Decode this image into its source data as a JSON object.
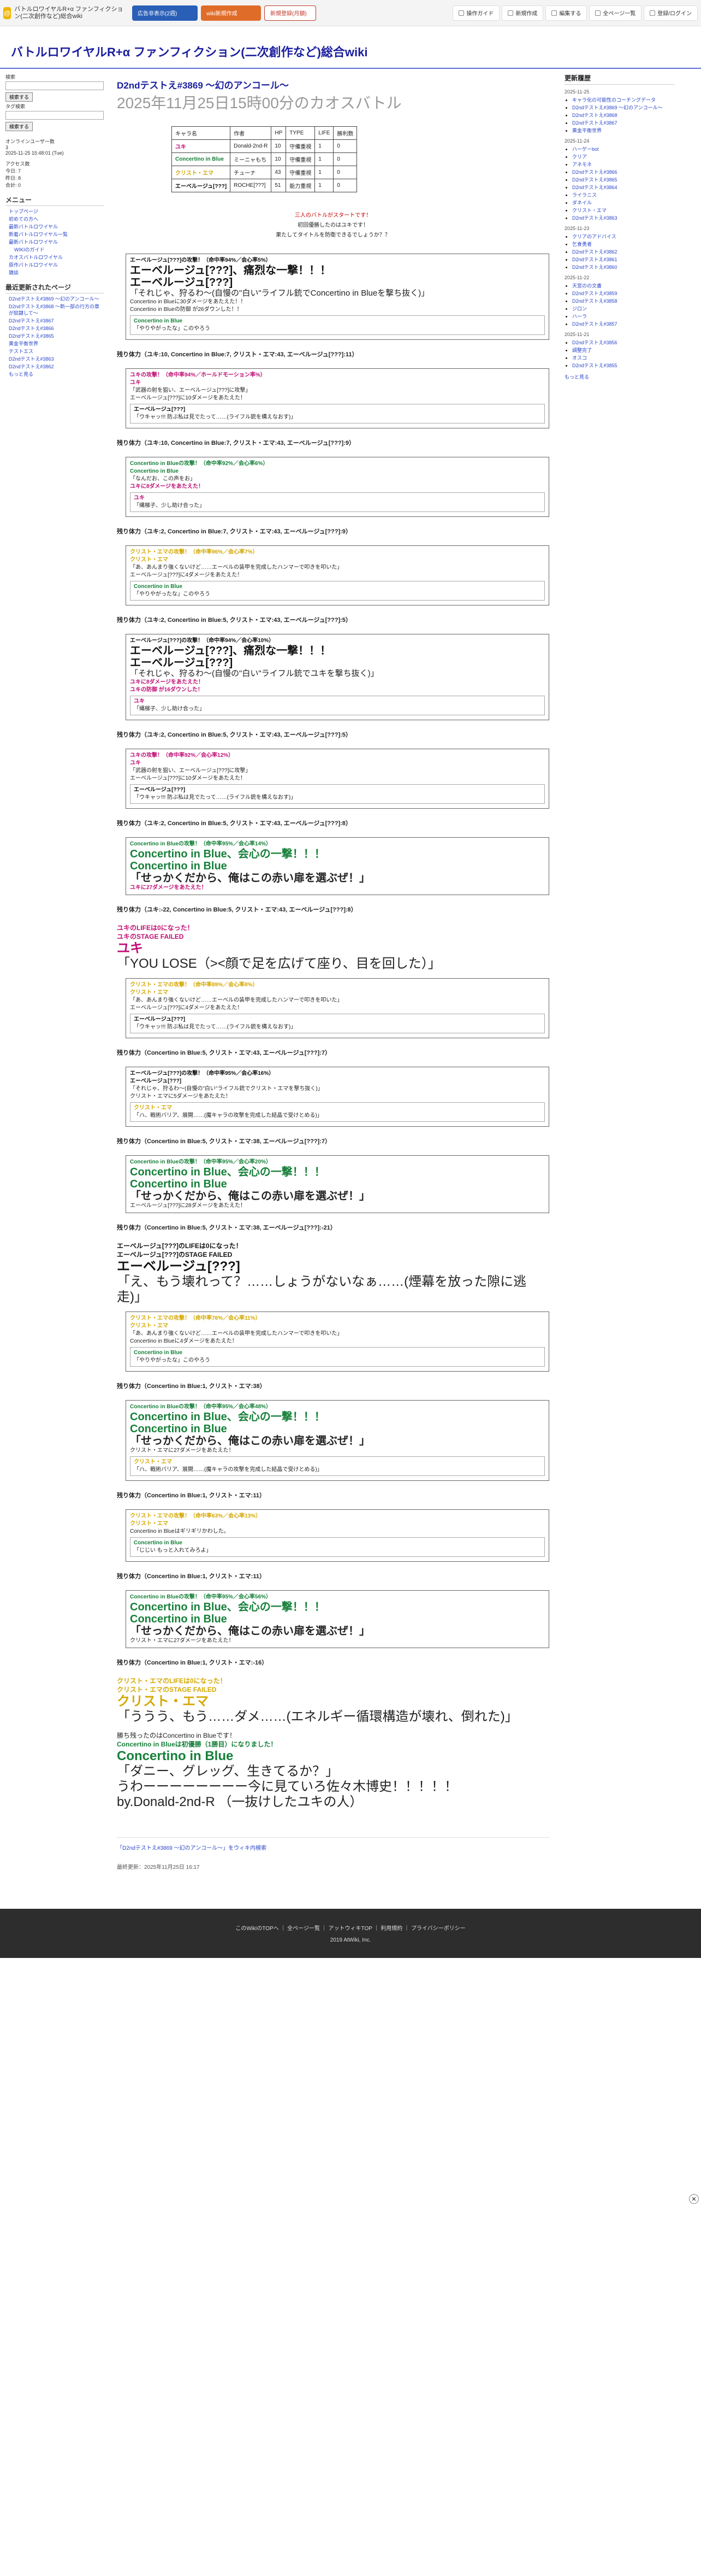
{
  "header": {
    "site_name": "バトルロワイヤルR+α ファンフィクション(二次創作など)総合wiki",
    "btn1": "広告非表示(2週)",
    "btn2": "wiki新規作成",
    "btn3": "新規登録(月額)",
    "nav": [
      "操作ガイド",
      "新規作成",
      "編集する",
      "全ページ一覧",
      "登録/ログイン"
    ]
  },
  "site_title": "バトルロワイヤルR+α ファンフィクション(二次創作など)総合wiki",
  "left": {
    "search_label": "検索",
    "search_btn": "検索する",
    "tag_label": "タグ検索",
    "tag_btn": "検索する",
    "online": "オンラインユーザー数",
    "online_val": "3",
    "stamp": "2025-11-25 15:48:01 (Tue)",
    "access": "アクセス数",
    "today": "今日: 7",
    "yesterday": "昨日: 8",
    "total": "合計: 0",
    "menu": "メニュー",
    "menu_items": [
      "トップページ",
      "初めての方へ",
      "最新バトルロワイヤル",
      "新着バトルロワイヤル一覧",
      "最新バトルロワイヤル",
      "WIKIのガイド",
      "カオスバトルロワイヤル",
      "原作バトルロワイヤル",
      "雑談"
    ],
    "related": "最近更新されたページ",
    "recent_items": [
      "D2ndテストえ#3869 〜幻のアンコール〜",
      "D2ndテストえ#3868 〜新一部の行方の章が奴隷して〜",
      "D2ndテストえ#3867",
      "D2ndテストえ#3866",
      "D2ndテストえ#3865",
      "黄金平衡世界",
      "テストエス",
      "D2ndテストえ#3863",
      "D2ndテストえ#3862",
      "もっと見る"
    ]
  },
  "page": {
    "title": "D2ndテストえ#3869 〜幻のアンコール〜",
    "subtitle": "2025年11月25日15時00分のカオスバトル"
  },
  "table": {
    "headers": [
      "キャラ名",
      "作者",
      "HP",
      "TYPE",
      "LIFE",
      "勝利数"
    ],
    "rows": [
      [
        "ユキ",
        "Donald-2nd-R",
        "10",
        "守備重視",
        "1",
        "0"
      ],
      [
        "Concertino in Blue",
        "ミーニャもち",
        "10",
        "守備重視",
        "1",
        "0"
      ],
      [
        "クリスト・エマ",
        "チューナ",
        "43",
        "守備重視",
        "1",
        "0"
      ],
      [
        "エーベルージュ[???]",
        "ROCHE[???]",
        "51",
        "能力重視",
        "1",
        "0"
      ]
    ]
  },
  "intro": {
    "l1": "三人のバトルがスタートです！",
    "l2": "初回優勝したのはユキです！",
    "l3": "果たしてタイトルを防衛できるでしょうか？？"
  },
  "rem_label": "残り体力",
  "footer_links": "このWikiのTOPへ ｜ 全ページ一覧 ｜ アットウィキTOP ｜ 利用規約 ｜ プライバシーポリシー",
  "copyright": "2019 AtWiki, Inc.",
  "rside": {
    "title": "更新履歴",
    "d1": "2025-11-25",
    "d2": "2025-11-24",
    "d3": "2025-11-23",
    "d4": "2025-11-22",
    "d5": "2025-11-21",
    "items1": [
      "キャラ化の可能性のコーチングデータ",
      "D2ndテストえ#3869 〜幻のアンコール〜",
      "D2ndテストえ#3868",
      "D2ndテストえ#3867",
      "黄金平衡世界"
    ],
    "items2": [
      "ハーゲーbot",
      "クリア",
      "アネモネ",
      "D2ndテストえ#3866",
      "D2ndテストえ#3865",
      "D2ndテストえ#3864",
      "ライラニス",
      "ダネイル",
      "クリスト・エマ",
      "D2ndテストえ#3863"
    ],
    "items3": [
      "クリアのアドバイス",
      "乞食勇者",
      "D2ndテストえ#3862",
      "D2ndテストえ#3861",
      "D2ndテストえ#3860"
    ],
    "items4": [
      "天宮のの文書",
      "D2ndテストえ#3859",
      "D2ndテストえ#3858",
      "ジロン",
      "ハーラ",
      "D2ndテストえ#3857"
    ],
    "items5": [
      "D2ndテストえ#3856",
      "調整完了",
      "オスコ",
      "D2ndテストえ#3855"
    ],
    "more": "もっと見る"
  },
  "last_update": "最終更新：2025年11月25日 16:17",
  "wiki_link": "「D2ndテストえ#3869 〜幻のアンコール〜」をウィキ内検索",
  "ending": {
    "l1": "勝ち残ったのはConcertino in Blueです！",
    "l2": "Concertino in Blueは初優勝（1勝目）になりました！",
    "n1": "Concertino in Blue",
    "q1": "「ダニー、グレッグ、生きてるか？」",
    "l3": "うわーーーーーーーー今に見ていろ佐々木博史！！！！！",
    "l4": "by.Donald-2nd-R （一抜けしたユキの人）"
  }
}
